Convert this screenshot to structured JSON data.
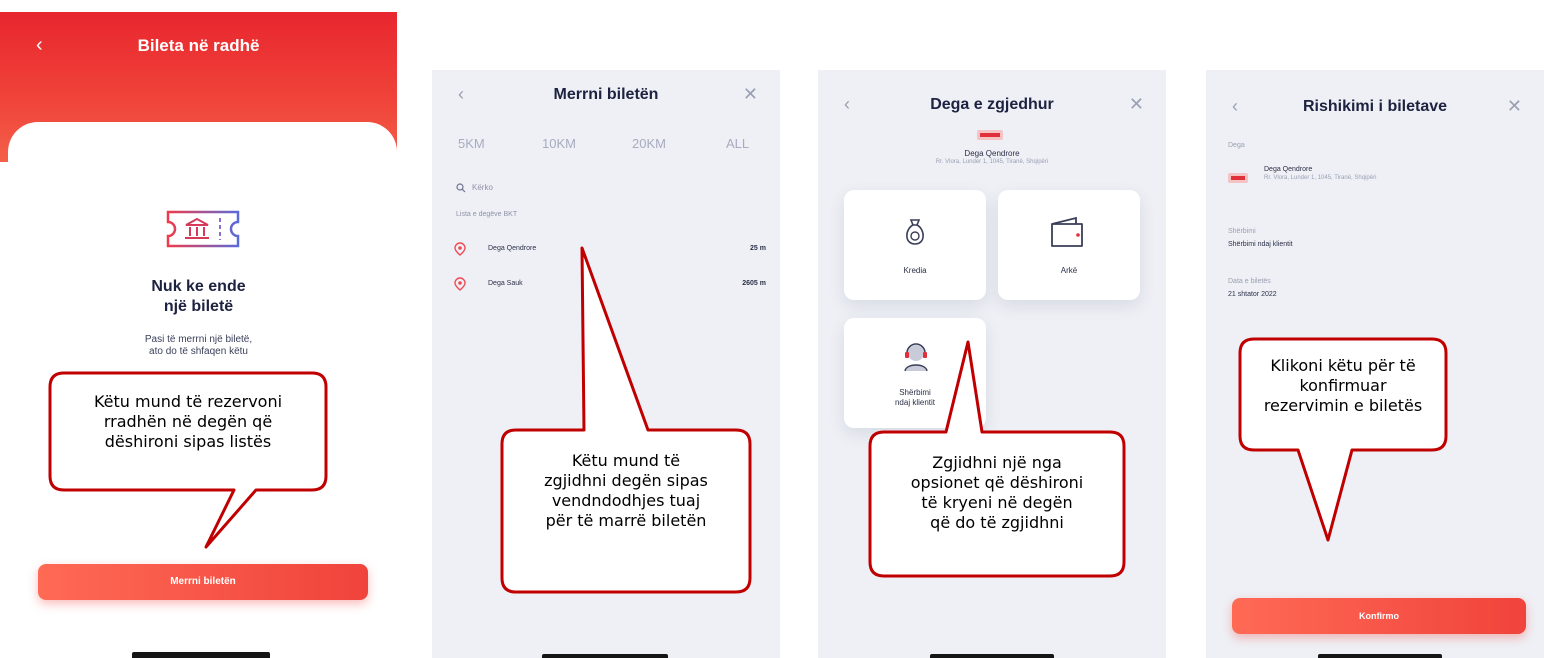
{
  "colors": {
    "brand_red": "#e8262e",
    "button_gradient_start": "#ff6a55",
    "button_gradient_end": "#f0433b",
    "screen_background": "#eef0f5",
    "callout_border": "#c00000"
  },
  "screen1": {
    "title": "Bileta në radhë",
    "back_icon": "chevron-left-icon",
    "empty_title_line1": "Nuk ke ende",
    "empty_title_line2": "një biletë",
    "empty_sub_line1": "Pasi të merrni një biletë,",
    "empty_sub_line2": "ato do të shfaqen këtu",
    "button_label": "Merrni biletën"
  },
  "screen2": {
    "title": "Merrni biletën",
    "filters": [
      "5KM",
      "10KM",
      "20KM",
      "ALL"
    ],
    "search_placeholder": "Kërko",
    "list_label": "Lista e degëve BKT",
    "branches": [
      {
        "name": "Dega Qendrore",
        "distance": "25 m"
      },
      {
        "name": "Dega Sauk",
        "distance": "2605 m"
      }
    ]
  },
  "screen3": {
    "title": "Dega e zgjedhur",
    "branch_name": "Dega Qendrore",
    "branch_address": "Rr. Vlora, Lunder 1, 1045, Tiranë, Shqipëri",
    "services": [
      "Kredia",
      "Arkë",
      "Shërbimi",
      "ndaj klientit"
    ]
  },
  "screen4": {
    "title": "Rishikimi i biletave",
    "branch_label": "Dega",
    "branch_name": "Dega Qendrore",
    "branch_address": "Rr. Vlora, Lunder 1, 1045, Tiranë, Shqipëri",
    "service_label": "Shërbimi",
    "service_value": "Shërbimi ndaj klientit",
    "date_label": "Data e biletës",
    "date_value": "21 shtator 2022",
    "button_label": "Konfirmo"
  },
  "callouts": {
    "c1": [
      "Këtu mund të rezervoni",
      "rradhën në degën që",
      "dëshironi sipas listës"
    ],
    "c2": [
      "Këtu mund të",
      "zgjidhni degën sipas",
      "vendndodhjes tuaj",
      "për të marrë biletën"
    ],
    "c3": [
      "Zgjidhni një nga",
      "opsionet që dëshironi",
      "të kryeni në degën",
      "që do të zgjidhni"
    ],
    "c4": [
      "Klikoni këtu për të",
      "konfirmuar",
      "rezervimin e biletës"
    ]
  }
}
